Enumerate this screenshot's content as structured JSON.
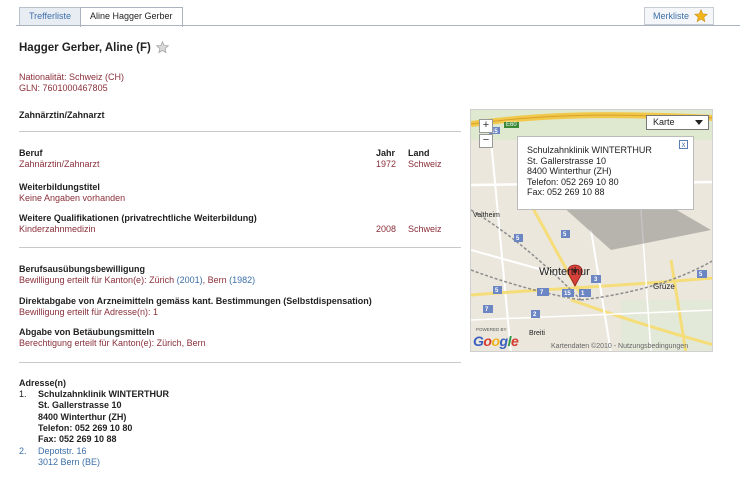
{
  "tabs": {
    "trefferliste": "Trefferliste",
    "active": "Aline Hagger Gerber",
    "merkliste": "Merkliste"
  },
  "person": {
    "name": "Hagger Gerber, Aline (F)",
    "nationality": "Nationalität: Schweiz (CH)",
    "gln": "GLN: 7601000467805"
  },
  "profession_heading": "Zahnärztin/Zahnarzt",
  "beruf_table": {
    "headers": {
      "beruf": "Beruf",
      "jahr": "Jahr",
      "land": "Land"
    },
    "row": {
      "beruf": "Zahnärztin/Zahnarzt",
      "jahr": "1972",
      "land": "Schweiz"
    }
  },
  "weiterbildung": {
    "title": "Weiterbildungstitel",
    "value": "Keine Angaben vorhanden"
  },
  "qualifikationen": {
    "title": "Weitere Qualifikationen (privatrechtliche Weiterbildung)",
    "value": "Kinderzahnmedizin",
    "jahr": "2008",
    "land": "Schweiz"
  },
  "bewilligung": {
    "title": "Berufsausübungsbewilligung",
    "prefix": "Bewilligung erteilt für Kanton(e): Zürich",
    "y1": "(2001)",
    "sep": ", Bern",
    "y2": "(1982)"
  },
  "direktabgabe": {
    "title": "Direktabgabe von Arzneimitteln gemäss kant. Bestimmungen (Selbstdispensation)",
    "value": "Bewilligung erteilt für Adresse(n): 1"
  },
  "betaeubung": {
    "title": "Abgabe von Betäubungsmitteln",
    "value": "Berechtigung erteilt für Kanton(e): Zürich, Bern"
  },
  "adressen": {
    "title": "Adresse(n)",
    "a1": {
      "num": "1.",
      "name": "Schulzahnklinik WINTERTHUR",
      "street": "St. Gallerstrasse 10",
      "city": "8400 Winterthur (ZH)",
      "tel": "Telefon: 052 269 10 80",
      "fax": "Fax: 052 269 10 88"
    },
    "a2": {
      "num": "2.",
      "street": "Depotstr. 16",
      "city": "3012 Bern (BE)"
    }
  },
  "map": {
    "type_select": "Karte",
    "zoom_in": "+",
    "zoom_out": "−",
    "bubble": {
      "name": "Schulzahnklinik WINTERTHUR",
      "street": "St. Gallerstrasse 10",
      "city": "8400 Winterthur (ZH)",
      "tel": "Telefon: 052 269 10 80",
      "fax": "Fax: 052 269 10 88",
      "close": "x"
    },
    "labels": {
      "winterthur": "Winterthur",
      "veltheim": "Veltheim",
      "gruze": "Grüze",
      "breiti": "Breiti",
      "e60": "E60"
    },
    "powered": "POWERED BY",
    "google": "Google",
    "footer": "Kartendaten ©2010 - Nutzungsbedingungen",
    "colors": {
      "highway": "#f2c84b",
      "road": "#ffffff",
      "rail": "#8d8d8d",
      "marker": "#d8413a",
      "route_badge": "#6c86c4"
    }
  },
  "colors": {
    "label_red": "#8a2f3a",
    "link_blue": "#3d6fa8",
    "star_gold": "#f2b51c"
  }
}
